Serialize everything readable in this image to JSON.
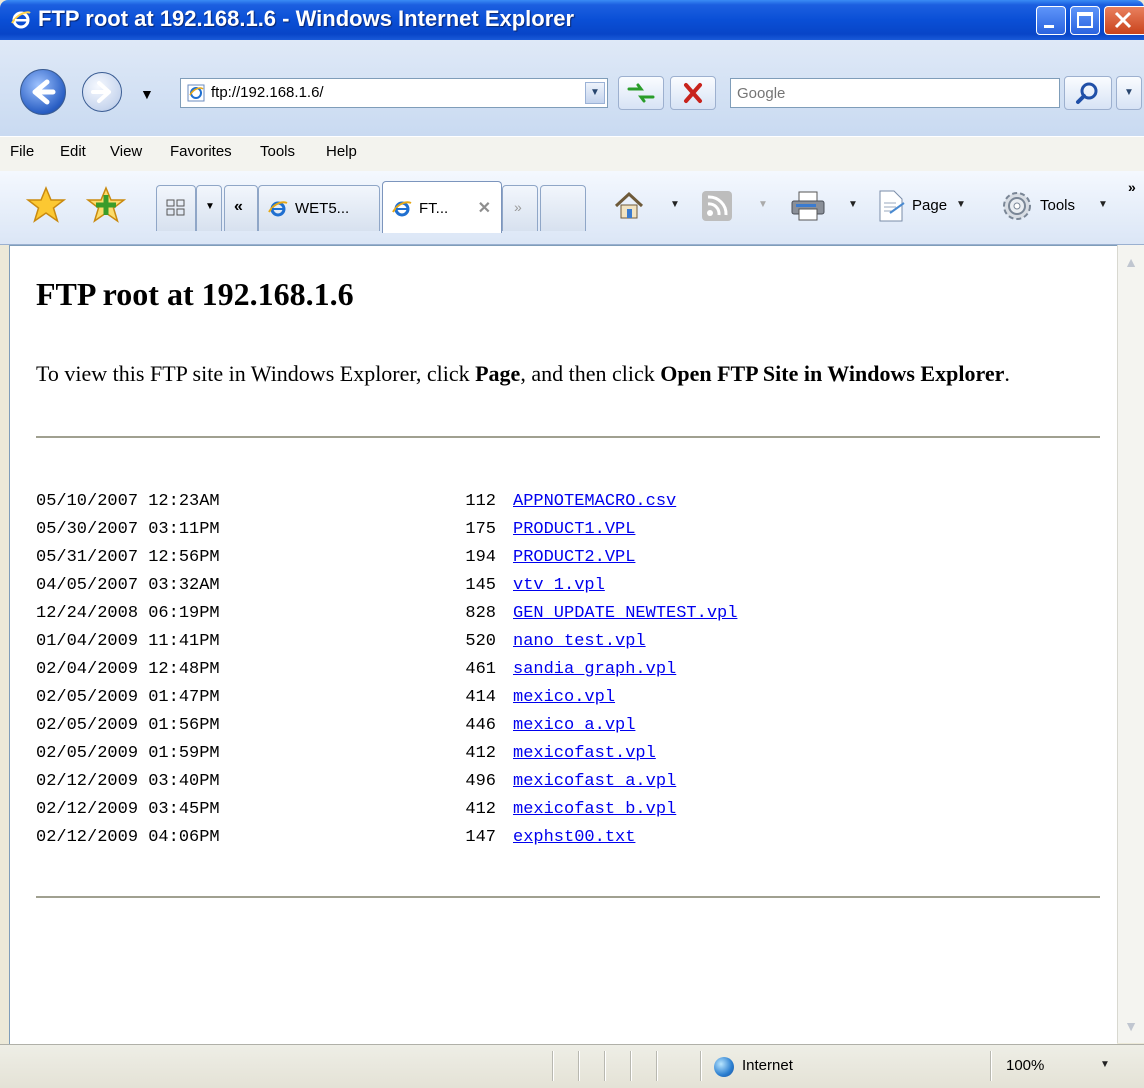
{
  "window": {
    "title": "FTP root at 192.168.1.6 - Windows Internet Explorer"
  },
  "addressbar": {
    "url": "ftp://192.168.1.6/",
    "search_placeholder": "Google"
  },
  "menu": [
    "File",
    "Edit",
    "View",
    "Favorites",
    "Tools",
    "Help"
  ],
  "tabs": {
    "items": [
      {
        "label": "WET5...",
        "active": false
      },
      {
        "label": "FT...",
        "active": true
      }
    ],
    "quick_tabs_icon": "quick-tabs-icon",
    "tab_list_label": "«",
    "new_tab_label": "»"
  },
  "commandbar": {
    "page_label": "Page",
    "tools_label": "Tools",
    "more_label": "»"
  },
  "page": {
    "heading": "FTP root at 192.168.1.6",
    "intro_pre": "To view this FTP site in Windows Explorer, click ",
    "intro_page": "Page",
    "intro_mid": ", and then click ",
    "intro_open": "Open FTP Site in Windows Explorer",
    "intro_end": "."
  },
  "files": [
    {
      "date": "05/10/2007 12:23AM",
      "size": "112",
      "name": "APPNOTEMACRO.csv"
    },
    {
      "date": "05/30/2007 03:11PM",
      "size": "175",
      "name": "PRODUCT1.VPL"
    },
    {
      "date": "05/31/2007 12:56PM",
      "size": "194",
      "name": "PRODUCT2.VPL"
    },
    {
      "date": "04/05/2007 03:32AM",
      "size": "145",
      "name": "vtv 1.vpl"
    },
    {
      "date": "12/24/2008 06:19PM",
      "size": "828",
      "name": "GEN UPDATE NEWTEST.vpl"
    },
    {
      "date": "01/04/2009 11:41PM",
      "size": "520",
      "name": "nano test.vpl"
    },
    {
      "date": "02/04/2009 12:48PM",
      "size": "461",
      "name": "sandia graph.vpl"
    },
    {
      "date": "02/05/2009 01:47PM",
      "size": "414",
      "name": "mexico.vpl"
    },
    {
      "date": "02/05/2009 01:56PM",
      "size": "446",
      "name": "mexico a.vpl"
    },
    {
      "date": "02/05/2009 01:59PM",
      "size": "412",
      "name": "mexicofast.vpl"
    },
    {
      "date": "02/12/2009 03:40PM",
      "size": "496",
      "name": "mexicofast a.vpl"
    },
    {
      "date": "02/12/2009 03:45PM",
      "size": "412",
      "name": "mexicofast b.vpl"
    },
    {
      "date": "02/12/2009 04:06PM",
      "size": "147",
      "name": "exphst00.txt"
    }
  ],
  "statusbar": {
    "zone": "Internet",
    "zoom": "100%"
  },
  "colors": {
    "link": "#0000ee",
    "titlebar": "#0a4fd6"
  }
}
